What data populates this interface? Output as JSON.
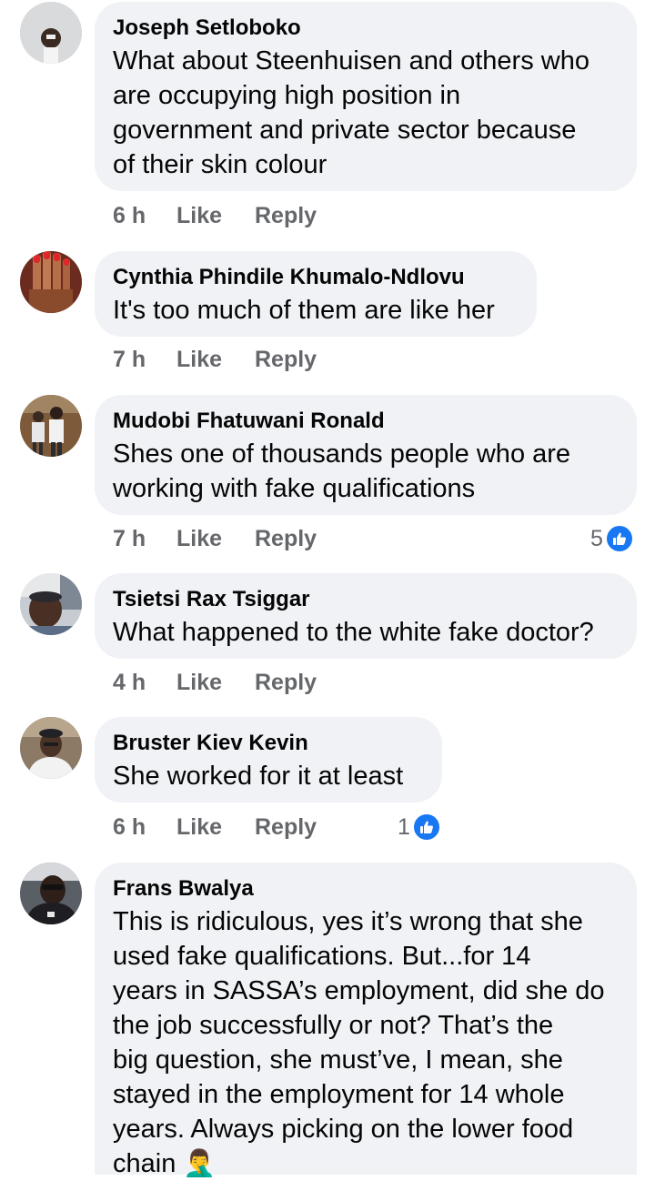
{
  "comments": [
    {
      "author": "Joseph Setloboko",
      "text_lines": [
        "What about Steenhuisen  and others who",
        "are occupying high position in",
        "government and private sector because",
        "of their skin colour"
      ],
      "time": "6 h",
      "like_label": "Like",
      "reply_label": "Reply"
    },
    {
      "author": "Cynthia Phindile Khumalo-Ndlovu",
      "text_lines": [
        "It's too much of them are like her"
      ],
      "time": "7 h",
      "like_label": "Like",
      "reply_label": "Reply"
    },
    {
      "author": "Mudobi Fhatuwani Ronald",
      "text_lines": [
        "Shes one of thousands people who are",
        "working with fake qualifications"
      ],
      "time": "7 h",
      "like_label": "Like",
      "reply_label": "Reply",
      "reaction_count": "5",
      "reaction_icon": "thumbs-up-icon"
    },
    {
      "author": "Tsietsi Rax Tsiggar",
      "text_lines": [
        "What happened to the white fake doctor?"
      ],
      "time": "4 h",
      "like_label": "Like",
      "reply_label": "Reply"
    },
    {
      "author": "Bruster Kiev Kevin",
      "text_lines": [
        "She worked for it at least"
      ],
      "time": "6 h",
      "like_label": "Like",
      "reply_label": "Reply",
      "reaction_count": "1",
      "reaction_icon": "thumbs-up-icon"
    },
    {
      "author": "Frans Bwalya",
      "text_lines": [
        "This is ridiculous, yes it’s wrong that she",
        "used fake qualifications. But...for 14",
        "years in SASSA’s employment, did she do",
        "the job successfully or not? That’s the",
        "big question, she must’ve, I mean, she",
        "stayed in the employment for 14 whole",
        "years. Always picking on the lower food",
        "chain 🤦‍♂️"
      ]
    }
  ],
  "colors": {
    "bubble_bg": "#f0f2f5",
    "meta_text": "#65676b",
    "like_blue": "#1877f2"
  }
}
